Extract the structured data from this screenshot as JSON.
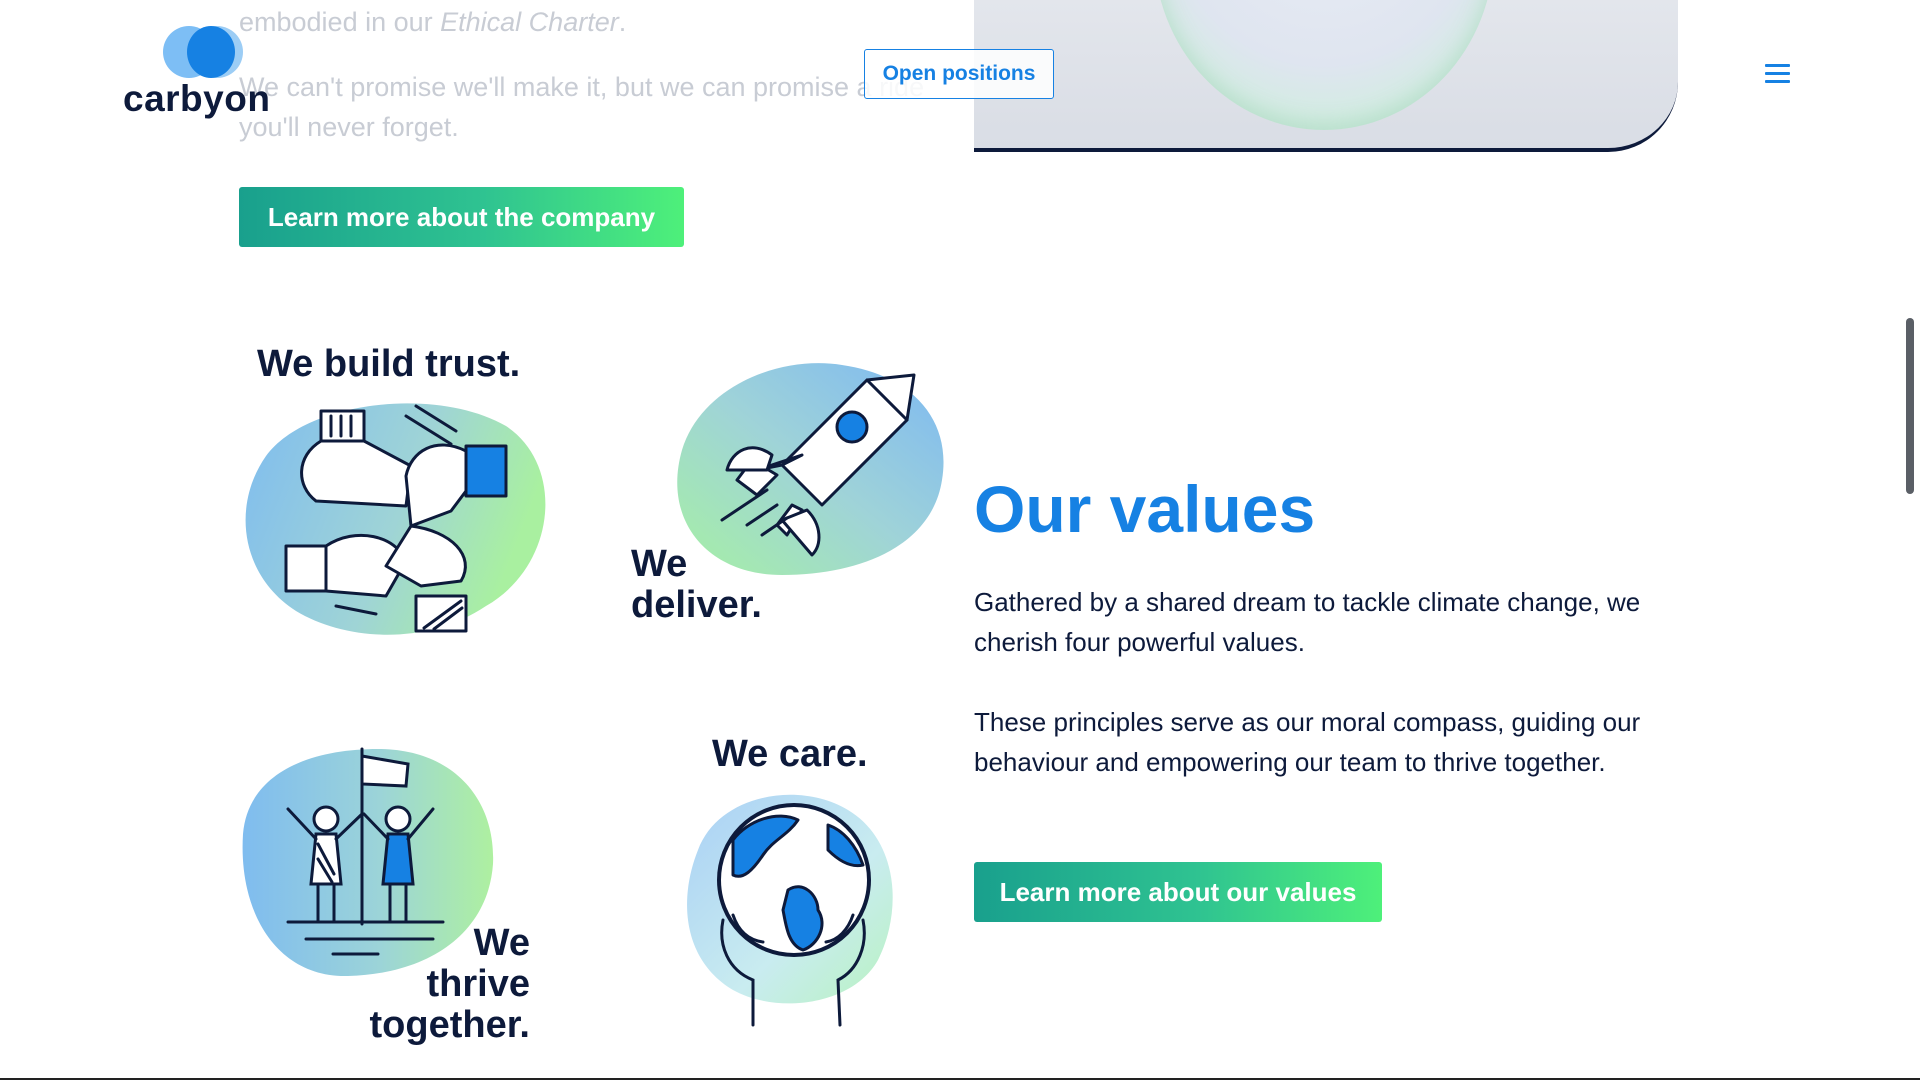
{
  "header": {
    "logo_text": "carbyon",
    "open_positions_label": "Open positions",
    "menu_icon": "hamburger-menu-icon"
  },
  "intro": {
    "line1_prefix": "embodied in our ",
    "line1_emphasis": "Ethical Charter",
    "line1_suffix": ".",
    "paragraph2": "We can't promise we'll make it, but we can promise a ride you'll never forget."
  },
  "company_button_label": "Learn more about the company",
  "values": {
    "title": "Our values",
    "paragraph1": "Gathered by a shared dream to tackle climate change, we cherish four powerful values.",
    "paragraph2": "These principles serve as our moral compass, guiding our behaviour and empowering our team to thrive together.",
    "button_label": "Learn more about our values",
    "items": [
      {
        "caption": "We build trust.",
        "icon": "hands-trust-icon"
      },
      {
        "caption_line1": "We",
        "caption_line2": "deliver.",
        "icon": "rocket-icon"
      },
      {
        "caption_line1": "We",
        "caption_line2": "thrive",
        "caption_line3": "together.",
        "icon": "people-flag-icon"
      },
      {
        "caption": "We care.",
        "icon": "globe-in-hands-icon"
      }
    ]
  },
  "colors": {
    "brand_blue": "#1681e3",
    "navy": "#0d1a3b",
    "green_start": "#19a08d",
    "green_end": "#4ef07a"
  }
}
